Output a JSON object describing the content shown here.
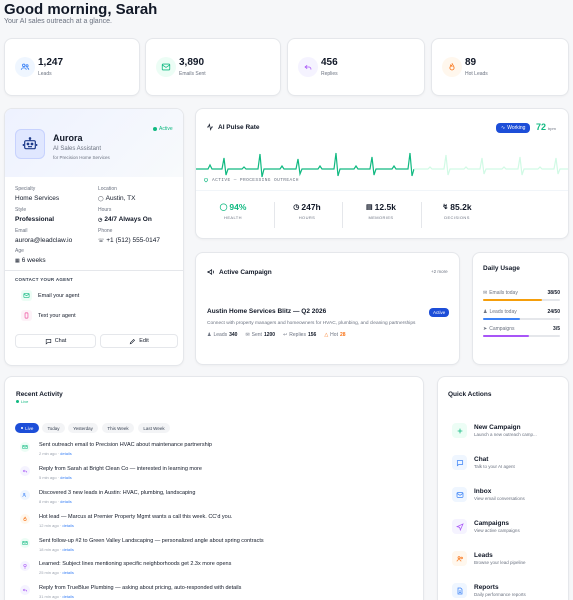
{
  "header": {
    "greeting": "Good morning, Sarah",
    "subtitle": "Your AI sales outreach at a glance."
  },
  "stats": [
    {
      "value": "1,247",
      "label": "Leads",
      "icon": "users-icon",
      "color": "#3b82f6",
      "bg": "#eff6ff"
    },
    {
      "value": "3,890",
      "label": "Emails Sent",
      "icon": "mail-icon",
      "color": "#10b981",
      "bg": "#ecfdf5"
    },
    {
      "value": "456",
      "label": "Replies",
      "icon": "reply-icon",
      "color": "#a855f7",
      "bg": "#f5f3ff"
    },
    {
      "value": "89",
      "label": "Hot Leads",
      "icon": "flame-icon",
      "color": "#f97316",
      "bg": "#fff7ed"
    }
  ],
  "agent": {
    "name": "Aurora",
    "status": "Active",
    "role": "AI Sales Assistant",
    "client": "for Precision Home Services",
    "fields": {
      "specialty_label": "Specialty",
      "specialty": "Home Services",
      "location_label": "Location",
      "location": "Austin, TX",
      "style_label": "Style",
      "style": "Professional",
      "hours_label": "Hours",
      "hours": "24/7 Always On",
      "email_label": "Email",
      "email": "aurora@leadclaw.io",
      "phone_label": "Phone",
      "phone": "+1 (512) 555-0147",
      "age_label": "Age",
      "age": "6 weeks"
    },
    "contact_heading": "CONTACT YOUR AGENT",
    "email_agent": "Email your agent",
    "text_agent": "Text your agent",
    "chat_label": "Chat",
    "edit_label": "Edit"
  },
  "pulse": {
    "title": "AI Pulse Rate",
    "badge": "Working",
    "rate": "72",
    "rate_unit": "bpm",
    "status_text": "ACTIVE — PROCESSING OUTREACH",
    "stats": [
      {
        "value": "94%",
        "label": "HEALTH",
        "icon": "shield-icon"
      },
      {
        "value": "247h",
        "label": "HOURS",
        "icon": "clock-icon"
      },
      {
        "value": "12.5k",
        "label": "MEMORIES",
        "icon": "database-icon"
      },
      {
        "value": "85.2k",
        "label": "DECISIONS",
        "icon": "zap-icon"
      }
    ]
  },
  "campaign": {
    "title": "Active Campaign",
    "more": "+2 more",
    "name": "Austin Home Services Blitz — Q2 2026",
    "status": "Active",
    "description": "Connect with property managers and homeowners for HVAC, plumbing, and cleaning partnerships",
    "leads_label": "Leads",
    "leads": "340",
    "sent_label": "Sent",
    "sent": "1200",
    "replies_label": "Replies",
    "replies": "156",
    "hot_label": "Hot",
    "hot": "28"
  },
  "usage": {
    "title": "Daily Usage",
    "items": [
      {
        "label": "Emails today",
        "value": "38/50",
        "fraction": 0.76,
        "color": "#f59e0b"
      },
      {
        "label": "Leads today",
        "value": "24/50",
        "fraction": 0.48,
        "color": "#3b82f6"
      },
      {
        "label": "Campaigns",
        "value": "3/5",
        "fraction": 0.6,
        "color": "#a855f7"
      }
    ]
  },
  "activity": {
    "title": "Recent Activity",
    "live": "Live",
    "filters": [
      "Live",
      "Today",
      "Yesterday",
      "This Week",
      "Last Week"
    ],
    "details_label": "details",
    "items": [
      {
        "text": "Sent outreach email to Precision HVAC about maintenance partnership",
        "time": "2 min ago",
        "icon": "mail-icon",
        "color": "#10b981",
        "bg": "#ecfdf5"
      },
      {
        "text": "Reply from Sarah at Bright Clean Co — interested in learning more",
        "time": "5 min ago",
        "icon": "reply-icon",
        "color": "#a855f7",
        "bg": "#f5f3ff"
      },
      {
        "text": "Discovered 3 new leads in Austin: HVAC, plumbing, landscaping",
        "time": "8 min ago",
        "icon": "users-icon",
        "color": "#3b82f6",
        "bg": "#eff6ff"
      },
      {
        "text": "Hot lead — Marcus at Premier Property Mgmt wants a call this week. CC'd you.",
        "time": "12 min ago",
        "icon": "flame-icon",
        "color": "#f97316",
        "bg": "#fff7ed"
      },
      {
        "text": "Sent follow-up #2 to Green Valley Landscaping — personalized angle about spring contracts",
        "time": "18 min ago",
        "icon": "mail-icon",
        "color": "#10b981",
        "bg": "#ecfdf5"
      },
      {
        "text": "Learned: Subject lines mentioning specific neighborhoods get 2.3x more opens",
        "time": "25 min ago",
        "icon": "bulb-icon",
        "color": "#a855f7",
        "bg": "#f5f3ff"
      },
      {
        "text": "Reply from TrueBlue Plumbing — asking about pricing, auto-responded with details",
        "time": "31 min ago",
        "icon": "reply-icon",
        "color": "#a855f7",
        "bg": "#f5f3ff"
      }
    ]
  },
  "quick_actions": {
    "title": "Quick Actions",
    "items": [
      {
        "title": "New Campaign",
        "sub": "Launch a new outreach camp...",
        "icon": "plus-icon",
        "color": "#10b981",
        "bg": "#ecfdf5"
      },
      {
        "title": "Chat",
        "sub": "Talk to your AI agent",
        "icon": "chat-icon",
        "color": "#3b82f6",
        "bg": "#eff6ff"
      },
      {
        "title": "Inbox",
        "sub": "View email conversations",
        "icon": "mail-icon",
        "color": "#3b82f6",
        "bg": "#eff6ff"
      },
      {
        "title": "Campaigns",
        "sub": "View active campaigns",
        "icon": "send-icon",
        "color": "#a855f7",
        "bg": "#f5f3ff"
      },
      {
        "title": "Leads",
        "sub": "Browse your lead pipeline",
        "icon": "users-icon",
        "color": "#f97316",
        "bg": "#fff7ed"
      },
      {
        "title": "Reports",
        "sub": "Daily performance reports",
        "icon": "file-icon",
        "color": "#3b82f6",
        "bg": "#eff6ff"
      }
    ]
  }
}
